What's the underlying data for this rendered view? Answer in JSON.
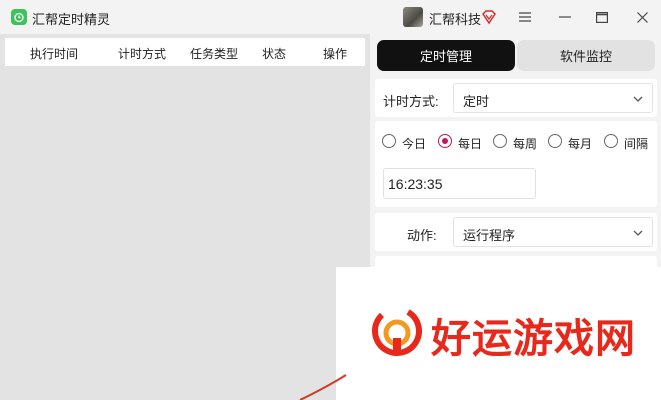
{
  "window": {
    "title": "汇帮定时精灵",
    "company": "汇帮科技",
    "brand_color": "#3cc35a"
  },
  "table": {
    "columns": [
      "执行时间",
      "计时方式",
      "任务类型",
      "状态",
      "操作"
    ],
    "rows": []
  },
  "tabs": [
    {
      "label": "定时管理",
      "active": true
    },
    {
      "label": "软件监控",
      "active": false
    }
  ],
  "timer": {
    "label": "计时方式:",
    "value": "定时"
  },
  "frequency": {
    "options": [
      "今日",
      "每日",
      "每周",
      "每月",
      "间隔"
    ],
    "selected": "每日",
    "accent": "#c2185b"
  },
  "time": {
    "value": "16:23:35"
  },
  "action": {
    "label": "动作:",
    "value": "运行程序"
  },
  "watermark": {
    "text": "好运游戏网",
    "color": "#e8281b"
  }
}
